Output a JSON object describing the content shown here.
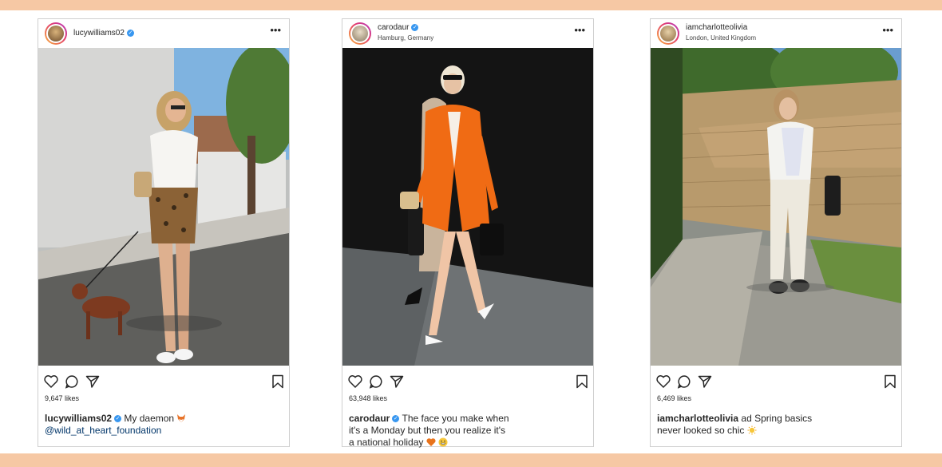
{
  "colors": {
    "band": "#f6c8a4",
    "verified": "#3897f0",
    "text": "#262626"
  },
  "icons": {
    "more": "more-options-icon",
    "like": "heart-icon",
    "comment": "comment-icon",
    "share": "send-icon",
    "save": "bookmark-icon",
    "verified": "verified-badge-icon"
  },
  "posts": [
    {
      "username": "lucywilliams02",
      "verified": true,
      "location": "",
      "more": "•••",
      "likes": "9,647 likes",
      "caption_user": "lucywilliams02",
      "caption_text": "My daemon",
      "caption_emoji": "fox-emoji",
      "caption_line2": "@wild_at_heart_foundation"
    },
    {
      "username": "carodaur",
      "verified": true,
      "location": "Hamburg, Germany",
      "more": "•••",
      "likes": "63,948 likes",
      "caption_user": "carodaur",
      "caption_text": "The face you make when",
      "caption_line2": "it's a Monday but then you realize it's",
      "caption_line3": "a national holiday",
      "caption_emoji": "heart-and-grin-emoji"
    },
    {
      "username": "iamcharlotteolivia",
      "verified": false,
      "location": "London, United Kingdom",
      "more": "•••",
      "likes": "6,469 likes",
      "caption_user": "iamcharlotteolivia",
      "caption_text": "ad Spring basics",
      "caption_line2": "never looked so chic",
      "caption_emoji": "sun-emoji"
    }
  ]
}
